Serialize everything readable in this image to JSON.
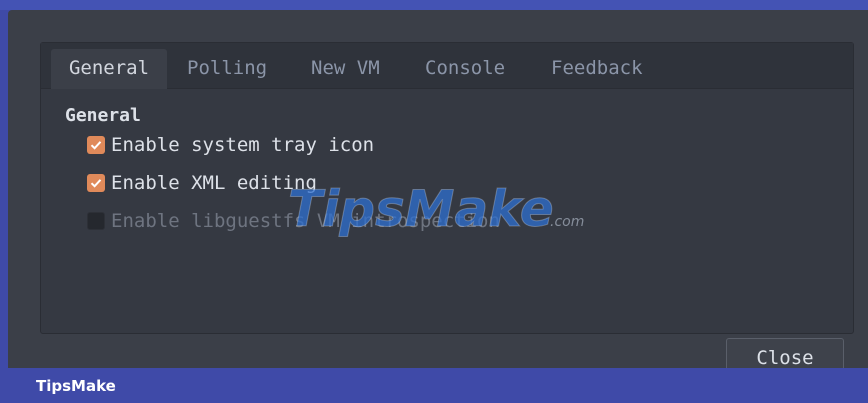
{
  "tabs": [
    {
      "label": "General"
    },
    {
      "label": "Polling"
    },
    {
      "label": "New VM"
    },
    {
      "label": "Console"
    },
    {
      "label": "Feedback"
    }
  ],
  "general": {
    "section_title": "General",
    "options": [
      {
        "label": "Enable system tray icon",
        "checked": true
      },
      {
        "label": "Enable XML editing",
        "checked": true
      },
      {
        "label": "Enable libguestfs VM introspection",
        "checked": false
      }
    ]
  },
  "close_label": "Close",
  "watermark": {
    "brand": "TipsMake",
    "suffix": ".com"
  },
  "footer": {
    "label": "TipsMake"
  },
  "colors": {
    "accent": "#e08a5a",
    "dialog_bg": "#3b3f48",
    "banner": "#3f4aa8"
  }
}
